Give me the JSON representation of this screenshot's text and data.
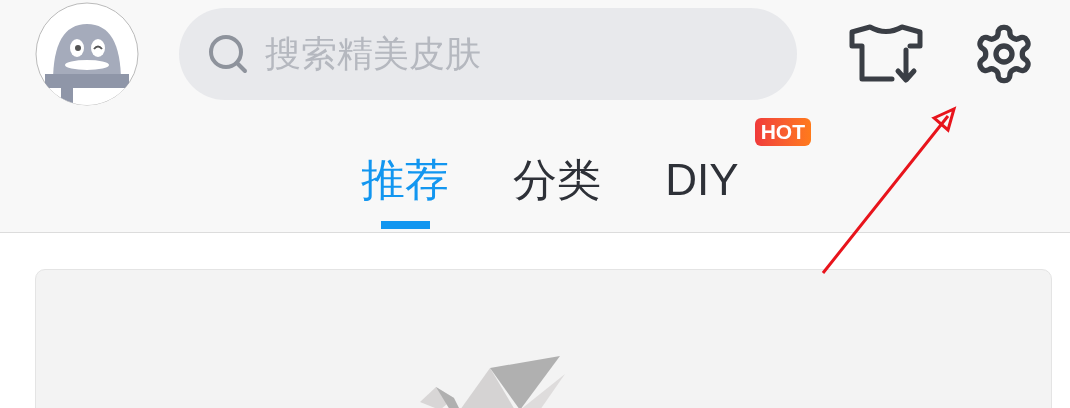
{
  "search": {
    "placeholder": "搜索精美皮肤"
  },
  "tabs": [
    {
      "label": "推荐",
      "selected": true
    },
    {
      "label": "分类",
      "selected": false
    },
    {
      "label": "DIY",
      "selected": false,
      "badge": "HOT"
    }
  ]
}
